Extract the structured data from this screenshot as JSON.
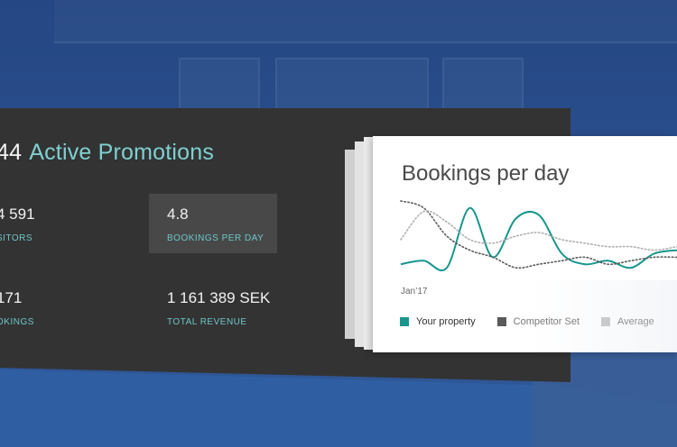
{
  "header": {
    "count": "44",
    "title": "Active Promotions"
  },
  "stats": [
    {
      "value": "4 591",
      "label": "SITORS"
    },
    {
      "value": "4.8",
      "label": "BOOKINGS PER DAY"
    },
    {
      "value": "171",
      "label": "OKINGS"
    },
    {
      "value": "1 161 389 SEK",
      "label": "TOTAL REVENUE"
    }
  ],
  "card": {
    "title": "Bookings per day",
    "x_tick": "Jan’17",
    "legend": [
      {
        "label": "Your property",
        "color": "#17968d"
      },
      {
        "label": "Competitor Set",
        "color": "#5a5a5a"
      },
      {
        "label": "Average",
        "color": "#c4c4c4"
      }
    ]
  },
  "chart_data": {
    "type": "line",
    "title": "Bookings per day",
    "xlabel": "",
    "ylabel": "",
    "x_ticks": [
      "Jan’17"
    ],
    "series": [
      {
        "name": "Your property",
        "color": "#17968d",
        "style": "solid",
        "x": [
          0,
          1,
          2,
          3,
          4,
          5,
          6,
          7,
          8,
          9,
          10,
          11,
          12
        ],
        "y": [
          0.1,
          0.15,
          0.05,
          0.9,
          0.2,
          0.75,
          0.8,
          0.25,
          0.1,
          0.15,
          0.05,
          0.25,
          0.3
        ]
      },
      {
        "name": "Competitor Set",
        "color": "#5a5a5a",
        "style": "dotted",
        "x": [
          0,
          1,
          2,
          3,
          4,
          5,
          6,
          7,
          8,
          9,
          10,
          11,
          12
        ],
        "y": [
          1.0,
          0.9,
          0.5,
          0.3,
          0.2,
          0.05,
          0.1,
          0.15,
          0.2,
          0.1,
          0.15,
          0.2,
          0.2
        ]
      },
      {
        "name": "Average",
        "color": "#b0b0b0",
        "style": "dotted",
        "x": [
          0,
          1,
          2,
          3,
          4,
          5,
          6,
          7,
          8,
          9,
          10,
          11,
          12
        ],
        "y": [
          0.45,
          0.85,
          0.7,
          0.45,
          0.4,
          0.5,
          0.55,
          0.45,
          0.4,
          0.35,
          0.35,
          0.3,
          0.35
        ]
      }
    ],
    "grid": false,
    "legend_position": "bottom"
  }
}
